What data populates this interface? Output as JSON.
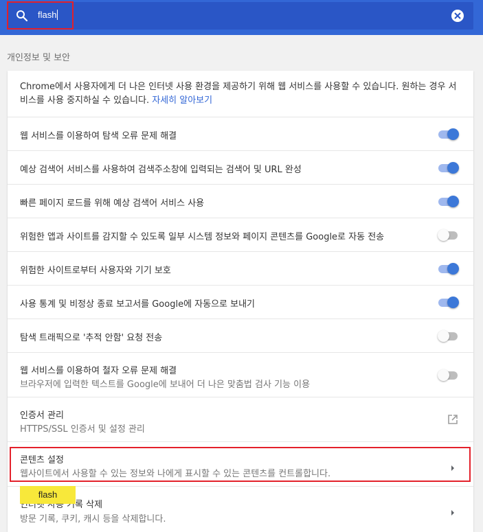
{
  "search": {
    "value": "flash"
  },
  "section": {
    "title": "개인정보 및 보안"
  },
  "intro": {
    "text": "Chrome에서 사용자에게 더 나은 인터넷 사용 환경을 제공하기 위해 웹 서비스를 사용할 수 있습니다. 원하는 경우 서비스를 사용 중지하실 수 있습니다.",
    "link": "자세히 알아보기"
  },
  "settings": [
    {
      "label": "웹 서비스를 이용하여 탐색 오류 문제 해결",
      "enabled": true
    },
    {
      "label": "예상 검색어 서비스를 사용하여 검색주소창에 입력되는 검색어 및 URL 완성",
      "enabled": true
    },
    {
      "label": "빠른 페이지 로드를 위해 예상 검색어 서비스 사용",
      "enabled": true
    },
    {
      "label": "위험한 앱과 사이트를 감지할 수 있도록 일부 시스템 정보와 페이지 콘텐츠를 Google로 자동 전송",
      "enabled": false
    },
    {
      "label": "위험한 사이트로부터 사용자와 기기 보호",
      "enabled": true
    },
    {
      "label": "사용 통계 및 비정상 종료 보고서를 Google에 자동으로 보내기",
      "enabled": true
    },
    {
      "label": "탐색 트래픽으로 '추적 안함' 요청 전송",
      "enabled": false
    },
    {
      "label": "웹 서비스를 이용하여 철자 오류 문제 해결",
      "sub": "브라우저에 입력한 텍스트를 Google에 보내어 더 나은 맞춤법 검사 기능 이용",
      "enabled": false
    }
  ],
  "links": [
    {
      "label": "인증서 관리",
      "sub": "HTTPS/SSL 인증서 및 설정 관리",
      "icon": "external-link-icon"
    },
    {
      "label": "콘텐츠 설정",
      "sub": "웹사이트에서 사용할 수 있는 정보와 나에게 표시할 수 있는 콘텐츠를 컨트롤합니다.",
      "icon": "arrow-right-icon"
    },
    {
      "label": "인터넷 사용 기록 삭제",
      "sub": "방문 기록, 쿠키, 캐시 등을 삭제합니다.",
      "icon": "arrow-right-icon"
    }
  ],
  "tooltip": {
    "text": "flash"
  },
  "colors": {
    "accent": "#3367d6",
    "highlight": "#e3202a",
    "tooltip": "#f8e83a"
  }
}
